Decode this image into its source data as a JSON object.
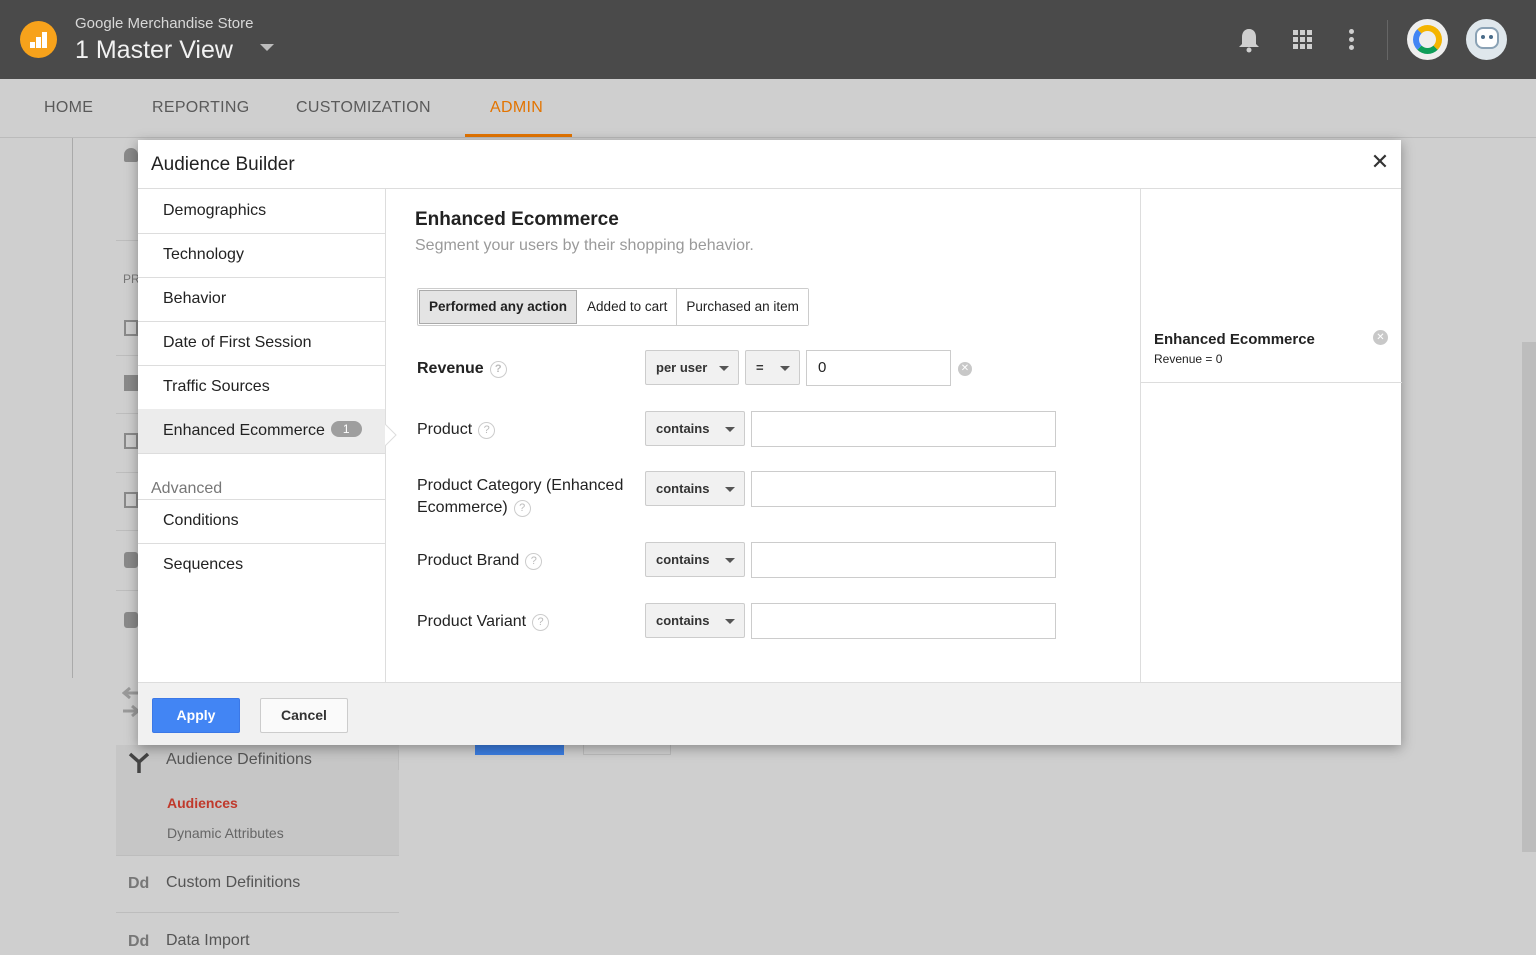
{
  "header": {
    "account_name": "Google Merchandise Store",
    "view_name": "1 Master View"
  },
  "nav": {
    "tabs": [
      {
        "label": "HOME"
      },
      {
        "label": "REPORTING"
      },
      {
        "label": "CUSTOMIZATION"
      },
      {
        "label": "ADMIN",
        "active": true
      }
    ]
  },
  "background": {
    "pr_label": "PR",
    "audience_definitions": "Audience Definitions",
    "audiences": "Audiences",
    "dynamic_attributes": "Dynamic Attributes",
    "custom_definitions": "Custom Definitions",
    "data_import": "Data Import",
    "dd_icon": "Dd"
  },
  "dialog": {
    "title": "Audience Builder",
    "close_glyph": "✕",
    "categories": [
      {
        "label": "Demographics"
      },
      {
        "label": "Technology"
      },
      {
        "label": "Behavior"
      },
      {
        "label": "Date of First Session"
      },
      {
        "label": "Traffic Sources"
      },
      {
        "label": "Enhanced Ecommerce",
        "badge": "1",
        "selected": true
      }
    ],
    "advanced_label": "Advanced",
    "advanced_items": [
      {
        "label": "Conditions"
      },
      {
        "label": "Sequences"
      }
    ],
    "section": {
      "title": "Enhanced Ecommerce",
      "subtitle": "Segment your users by their shopping behavior.",
      "segments": [
        {
          "label": "Performed any action",
          "selected": true
        },
        {
          "label": "Added to cart"
        },
        {
          "label": "Purchased an item"
        }
      ],
      "rows": [
        {
          "label": "Revenue",
          "scope": "per user",
          "operator": "=",
          "value": "0"
        },
        {
          "label": "Product",
          "operator": "contains",
          "value": ""
        },
        {
          "label_line1": "Product Category (Enhanced",
          "label_line2": "Ecommerce)",
          "operator": "contains",
          "value": ""
        },
        {
          "label": "Product Brand",
          "operator": "contains",
          "value": ""
        },
        {
          "label": "Product Variant",
          "operator": "contains",
          "value": ""
        }
      ],
      "help_glyph": "?"
    },
    "summary": {
      "title": "Enhanced Ecommerce",
      "condition": "Revenue = 0"
    },
    "footer": {
      "apply_label": "Apply",
      "cancel_label": "Cancel"
    }
  },
  "colors": {
    "topbar": "#4a4a4a",
    "accent": "#e37400",
    "primary_button": "#4285f4"
  },
  "icons": [
    "analytics-logo-icon",
    "notifications-bell-icon",
    "apps-grid-icon",
    "more-vert-icon",
    "chrome-icon",
    "user-avatar-icon",
    "close-icon",
    "help-icon",
    "clear-icon",
    "chevron-down-icon"
  ]
}
